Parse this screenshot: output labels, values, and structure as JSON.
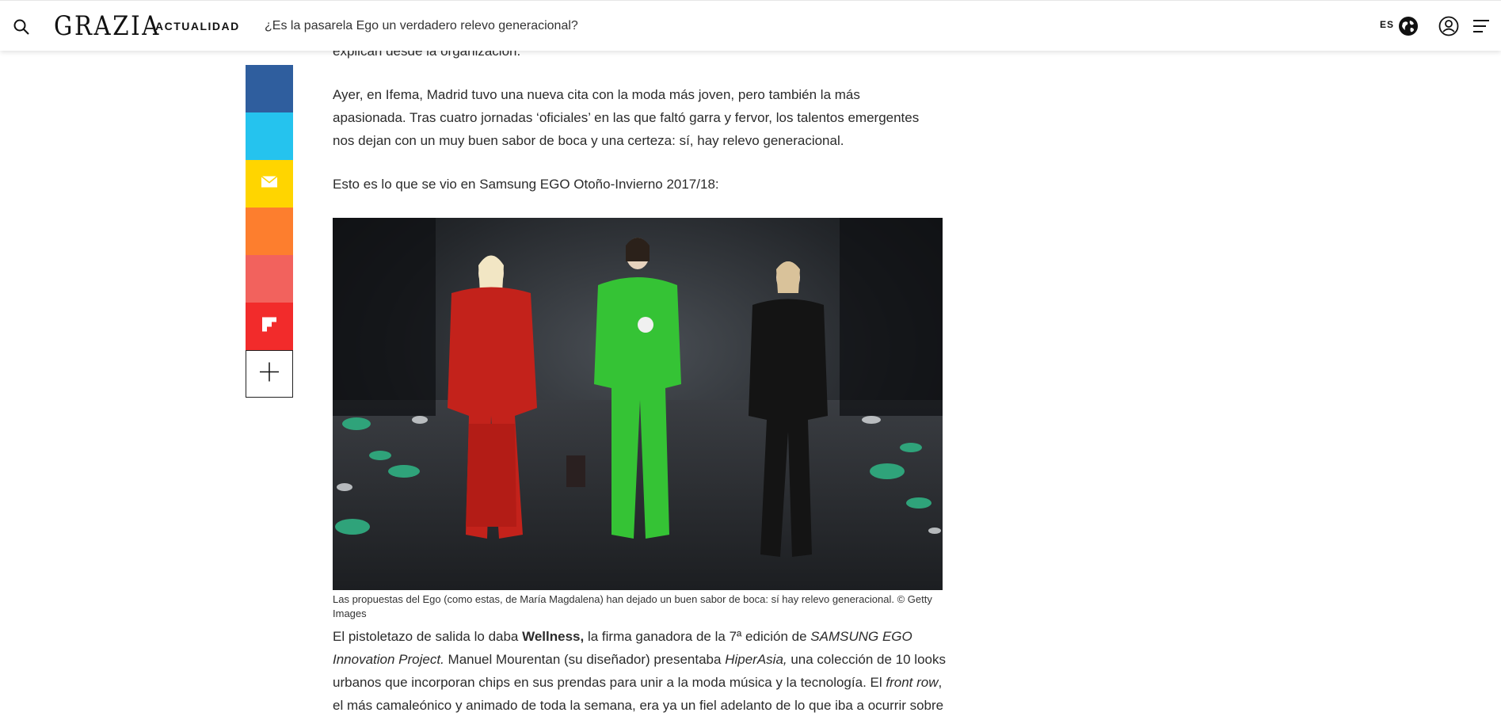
{
  "header": {
    "logo": "GRAZIA",
    "section": "ACTUALIDAD",
    "article_title": "¿Es la pasarela Ego un verdadero relevo generacional?",
    "lang": "ES",
    "icons": [
      "search-icon",
      "globe-icon",
      "user-icon",
      "menu-icon"
    ]
  },
  "share": {
    "buttons": [
      {
        "name": "facebook",
        "color": "#2f5e9e"
      },
      {
        "name": "twitter",
        "color": "#25c3ee"
      },
      {
        "name": "email",
        "color": "#ffd500"
      },
      {
        "name": "share-orange",
        "color": "#fd7e2e"
      },
      {
        "name": "share-pink",
        "color": "#f2625d"
      },
      {
        "name": "flipboard",
        "color": "#f22b2b"
      },
      {
        "name": "more",
        "color": "#ffffff"
      }
    ]
  },
  "article": {
    "cut_line": "explican desde la organización.",
    "para1": "Ayer, en Ifema, Madrid tuvo una nueva cita con la moda más joven, pero también la más apasionada. Tras cuatro jornadas ‘oficiales’ en las que faltó garra y fervor, los talentos emergentes nos dejan con un muy buen sabor de boca y una certeza: sí, hay relevo generacional.",
    "para2": "Esto es lo que se vio en Samsung EGO Otoño-Invierno 2017/18:",
    "caption": "Las propuestas del Ego (como estas, de María Magdalena) han dejado un buen sabor de boca: sí hay relevo generacional. © Getty Images",
    "para3": {
      "t1": "El pistoletazo de salida lo daba ",
      "b1": "Wellness,",
      "t2": " la firma ganadora de la 7ª edición de ",
      "i1": "SAMSUNG EGO Innovation Project.",
      "t3": " Manuel Mourentan (su diseñador) presentaba ",
      "i2": "HiperAsia,",
      "t4": " una colección de 10 looks urbanos que incorporan chips en sus prendas para unir a la moda música y la tecnología. El ",
      "i3": "front row",
      "t5": ", el más camaleónico y animado de toda la semana, era ya un fiel adelanto de lo que iba a ocurrir sobre la pasarela: actuación musical"
    }
  }
}
